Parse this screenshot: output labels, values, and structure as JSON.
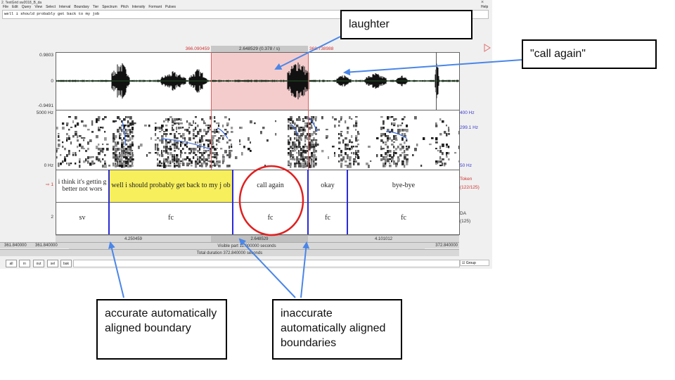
{
  "window": {
    "title": "2. TextGrid sw2018_B_da",
    "close": "×",
    "menu": [
      "File",
      "Edit",
      "Query",
      "View",
      "Select",
      "Interval",
      "Boundary",
      "Tier",
      "Spectrum",
      "Pitch",
      "Intensity",
      "Formant",
      "Pulses"
    ],
    "help": "Help"
  },
  "transcript": "well i should probably get back to my job",
  "selection": {
    "start": "366.090459",
    "duration": "2.648529 (0.378 / s)",
    "end": "368.738988"
  },
  "waveform": {
    "max": "0.9803",
    "zero": "0",
    "min": "-0.9491"
  },
  "spectrogram": {
    "top": "5000 Hz",
    "bottom": "0 Hz",
    "pitch_top": "400 Hz",
    "pitch_value": "299.1 Hz",
    "pitch_bottom": "50 Hz"
  },
  "tiers": [
    {
      "number": "1",
      "marker": "⇨ 1",
      "name": "Token",
      "count": "(122/125)",
      "intervals": [
        "i think it's gettin g better not wors",
        "well i should probably get back to my j ob",
        "call again",
        "okay",
        "bye-bye"
      ]
    },
    {
      "number": "2",
      "name": "DA",
      "count": "(125)",
      "intervals": [
        "sv",
        "fc",
        "fc",
        "fc",
        "fc"
      ]
    }
  ],
  "durations": [
    "4.250459",
    "2.648529",
    "4.101012"
  ],
  "visible": {
    "left_outer": "361.840000",
    "left": "361.840000",
    "label": "Visible part 11.000000 seconds",
    "right": "372.840000",
    "total": "Total duration 372.840000 seconds"
  },
  "zoom_buttons": [
    "all",
    "in",
    "out",
    "sel",
    "bak"
  ],
  "group_label": "Group",
  "callouts": {
    "laughter": "laughter",
    "call_again": "\"call again\"",
    "accurate": "accurate automatically aligned boundary",
    "inaccurate": "inaccurate automatically aligned boundaries"
  },
  "colors": {
    "selection": "#f4cccc",
    "highlight": "#f7ef5b",
    "boundary": "#2a2ad8",
    "arrow": "#4a86e8",
    "circle": "#e02020"
  }
}
